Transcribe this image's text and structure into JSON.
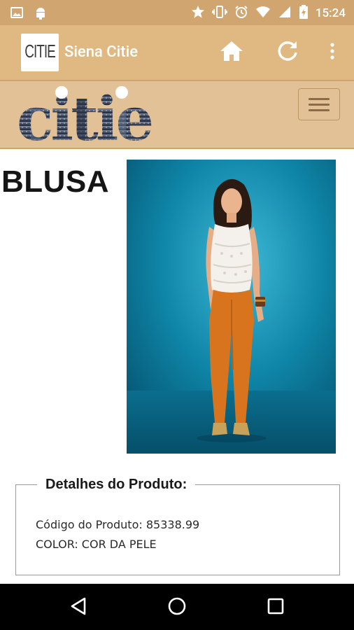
{
  "status_bar": {
    "time": "15:24",
    "left_icons": [
      "image-icon",
      "android-icon"
    ],
    "right_icons": [
      "star-icon",
      "vibrate-icon",
      "alarm-icon",
      "wifi-icon",
      "signal-icon",
      "battery-icon"
    ]
  },
  "app_bar": {
    "logo_text": "CITIE",
    "title": "Siena Citie",
    "actions": [
      "home-icon",
      "refresh-icon",
      "overflow-menu-icon"
    ]
  },
  "site_header": {
    "logo_text": "citie",
    "menu_icon": "hamburger-icon"
  },
  "product": {
    "title": "BLUSA",
    "image_description": "product-photo"
  },
  "details": {
    "legend": "Detalhes do Produto:",
    "code_line": "Código do Produto: 85338.99",
    "color_line": "COLOR: COR DA PELE"
  },
  "nav_bar": {
    "buttons": [
      "back-icon",
      "home-circle-icon",
      "recents-icon"
    ]
  },
  "colors": {
    "status_bar": "#d1a56f",
    "app_bar": "#e0b882",
    "site_header": "#e3c196",
    "photo_background": "#0f86a8",
    "pants": "#d9741e"
  }
}
